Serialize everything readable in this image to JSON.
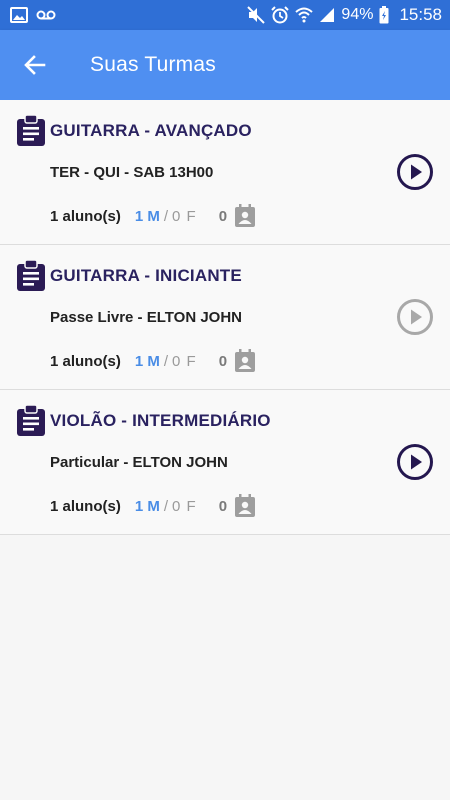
{
  "status_bar": {
    "battery": "94%",
    "time": "15:58",
    "icons": [
      "image-icon",
      "voicemail-icon",
      "mute-icon",
      "alarm-icon",
      "wifi-icon",
      "signal-icon",
      "battery-icon"
    ]
  },
  "app_bar": {
    "title": "Suas Turmas",
    "back_icon": "arrow-left-icon"
  },
  "colors": {
    "status_bar": "#2f6fd6",
    "app_bar": "#4f8ff1",
    "title_text": "#2a2260",
    "play_active": "#24174f",
    "play_disabled": "#a8a8a8",
    "male_count": "#4a8de6"
  },
  "classes": [
    {
      "title": "GUITARRA - AVANÇADO",
      "subtitle": "TER - QUI - SAB 13H00",
      "students": "1 aluno(s)",
      "male": "1 M",
      "separator": "/",
      "female": "0 F",
      "count": "0",
      "play_enabled": true
    },
    {
      "title": "GUITARRA - INICIANTE",
      "subtitle": "Passe Livre - ELTON JOHN",
      "students": "1 aluno(s)",
      "male": "1 M",
      "separator": "/",
      "female": "0 F",
      "count": "0",
      "play_enabled": false
    },
    {
      "title": "VIOLÃO - INTERMEDIÁRIO",
      "subtitle": "Particular - ELTON JOHN",
      "students": "1 aluno(s)",
      "male": "1 M",
      "separator": "/",
      "female": "0 F",
      "count": "0",
      "play_enabled": true
    }
  ]
}
